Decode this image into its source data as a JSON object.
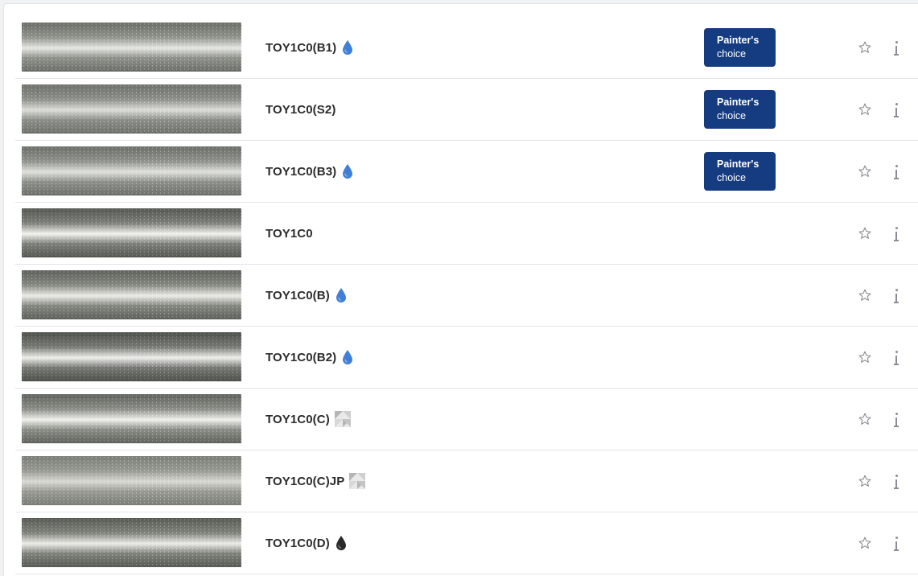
{
  "colors": {
    "badge_bg": "#153b80",
    "water_drop": "#3f7fd6",
    "solvent_drop": "#2a2a2a",
    "icon_gray": "#8a8d93"
  },
  "badge": {
    "line1": "Painter's",
    "line2": "choice"
  },
  "rows": [
    {
      "name": "TOY1C0(B1)",
      "marker": "water-drop-icon",
      "painters_choice": true,
      "swatch": {
        "base": "#8f918b",
        "highlight": "#e6e7e2",
        "dark": "#6b6d68"
      }
    },
    {
      "name": "TOY1C0(S2)",
      "marker": "",
      "painters_choice": true,
      "swatch": {
        "base": "#8c8e89",
        "highlight": "#dcddd8",
        "dark": "#6e706b"
      }
    },
    {
      "name": "TOY1C0(B3)",
      "marker": "water-drop-icon",
      "painters_choice": true,
      "swatch": {
        "base": "#8e908b",
        "highlight": "#e0e1dc",
        "dark": "#6c6e69"
      }
    },
    {
      "name": "TOY1C0",
      "marker": "",
      "painters_choice": false,
      "swatch": {
        "base": "#7d7f7a",
        "highlight": "#f2f2ee",
        "dark": "#555752"
      }
    },
    {
      "name": "TOY1C0(B)",
      "marker": "water-drop-icon",
      "painters_choice": false,
      "swatch": {
        "base": "#858781",
        "highlight": "#ecece7",
        "dark": "#5e605b"
      }
    },
    {
      "name": "TOY1C0(B2)",
      "marker": "water-drop-icon",
      "painters_choice": false,
      "swatch": {
        "base": "#777975",
        "highlight": "#eeeeea",
        "dark": "#4e504b"
      }
    },
    {
      "name": "TOY1C0(C)",
      "marker": "conversion-icon",
      "painters_choice": false,
      "swatch": {
        "base": "#8a8c86",
        "highlight": "#f0f0ec",
        "dark": "#60625d"
      }
    },
    {
      "name": "TOY1C0(C)JP",
      "marker": "conversion-icon",
      "painters_choice": false,
      "swatch": {
        "base": "#979992",
        "highlight": "#d8d9d3",
        "dark": "#7b7d77"
      }
    },
    {
      "name": "TOY1C0(D)",
      "marker": "solvent-drop-icon",
      "painters_choice": false,
      "swatch": {
        "base": "#7f817b",
        "highlight": "#ecece7",
        "dark": "#585a55"
      }
    }
  ]
}
